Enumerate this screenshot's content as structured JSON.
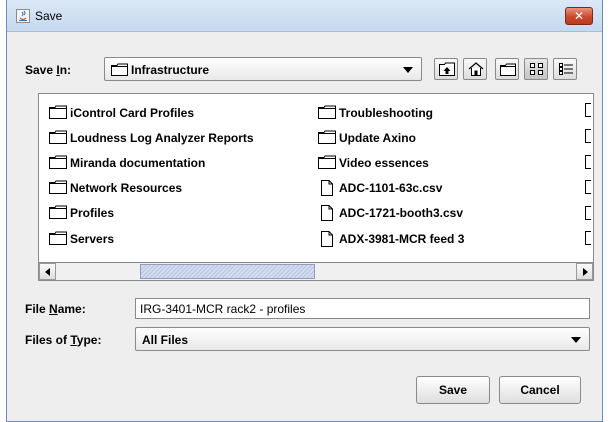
{
  "window": {
    "title": "Save",
    "title_icon": "java-app-icon",
    "close_glyph": "✕",
    "close_color": "#c94a2e"
  },
  "save_in": {
    "label_prefix": "Save ",
    "label_mnemonic": "I",
    "label_suffix": "n:",
    "value": "Infrastructure",
    "value_icon": "folder-icon"
  },
  "toolbar": {
    "buttons": [
      {
        "name": "up-one-level",
        "icon": "up-folder-icon"
      },
      {
        "name": "home",
        "icon": "home-icon"
      },
      {
        "name": "new-folder",
        "icon": "new-folder-icon"
      },
      {
        "name": "list-view",
        "icon": "list-view-icon"
      },
      {
        "name": "details-view",
        "icon": "details-view-icon"
      }
    ]
  },
  "files": {
    "col1": [
      {
        "name": "iControl Card Profiles",
        "type": "folder"
      },
      {
        "name": "Loudness Log Analyzer Reports",
        "type": "folder"
      },
      {
        "name": "Miranda documentation",
        "type": "folder"
      },
      {
        "name": "Network Resources",
        "type": "folder"
      },
      {
        "name": "Profiles",
        "type": "folder"
      },
      {
        "name": "Servers",
        "type": "folder"
      }
    ],
    "col2": [
      {
        "name": "Troubleshooting",
        "type": "folder"
      },
      {
        "name": "Update Axino",
        "type": "folder"
      },
      {
        "name": "Video essences",
        "type": "folder"
      },
      {
        "name": "ADC-1101-63c.csv",
        "type": "file"
      },
      {
        "name": "ADC-1721-booth3.csv",
        "type": "file"
      },
      {
        "name": "ADX-3981-MCR feed 3",
        "type": "file"
      }
    ]
  },
  "file_name": {
    "label_prefix": "File ",
    "label_mnemonic": "N",
    "label_suffix": "ame:",
    "value": "IRG-3401-MCR rack2 - profiles"
  },
  "file_type": {
    "label_prefix": "Files of ",
    "label_mnemonic": "T",
    "label_suffix": "ype:",
    "value": "All Files"
  },
  "buttons": {
    "save": "Save",
    "cancel": "Cancel"
  },
  "colors": {
    "background": "#eeeeee",
    "scroll_thumb": "#c4cde6",
    "folder_outline": "#000000"
  }
}
